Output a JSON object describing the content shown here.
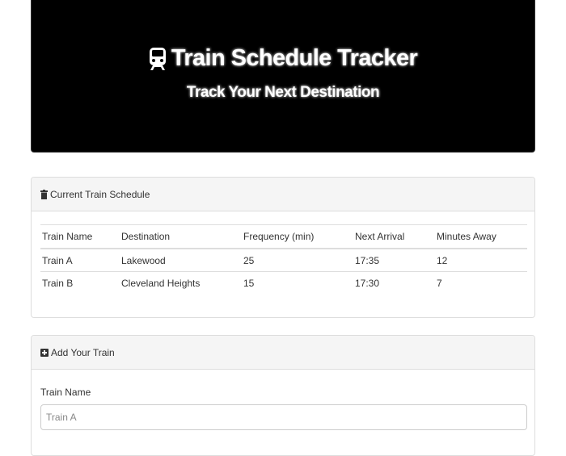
{
  "header": {
    "title": "Train Schedule Tracker",
    "subtitle": "Track Your Next Destination",
    "icon": "train-icon"
  },
  "schedule_panel": {
    "title": "Current Train Schedule",
    "icon": "trash-icon",
    "columns": [
      "Train Name",
      "Destination",
      "Frequency (min)",
      "Next Arrival",
      "Minutes Away"
    ],
    "rows": [
      [
        "Train A",
        "Lakewood",
        "25",
        "17:35",
        "12"
      ],
      [
        "Train B",
        "Cleveland Heights",
        "15",
        "17:30",
        "7"
      ]
    ]
  },
  "add_panel": {
    "title": "Add Your Train",
    "icon": "plus-square-icon",
    "train_name_label": "Train Name",
    "train_name_placeholder": "Train A"
  },
  "colors": {
    "jumbotron_bg": "#000000",
    "panel_heading_bg": "#f5f5f5",
    "border": "#dddddd"
  }
}
